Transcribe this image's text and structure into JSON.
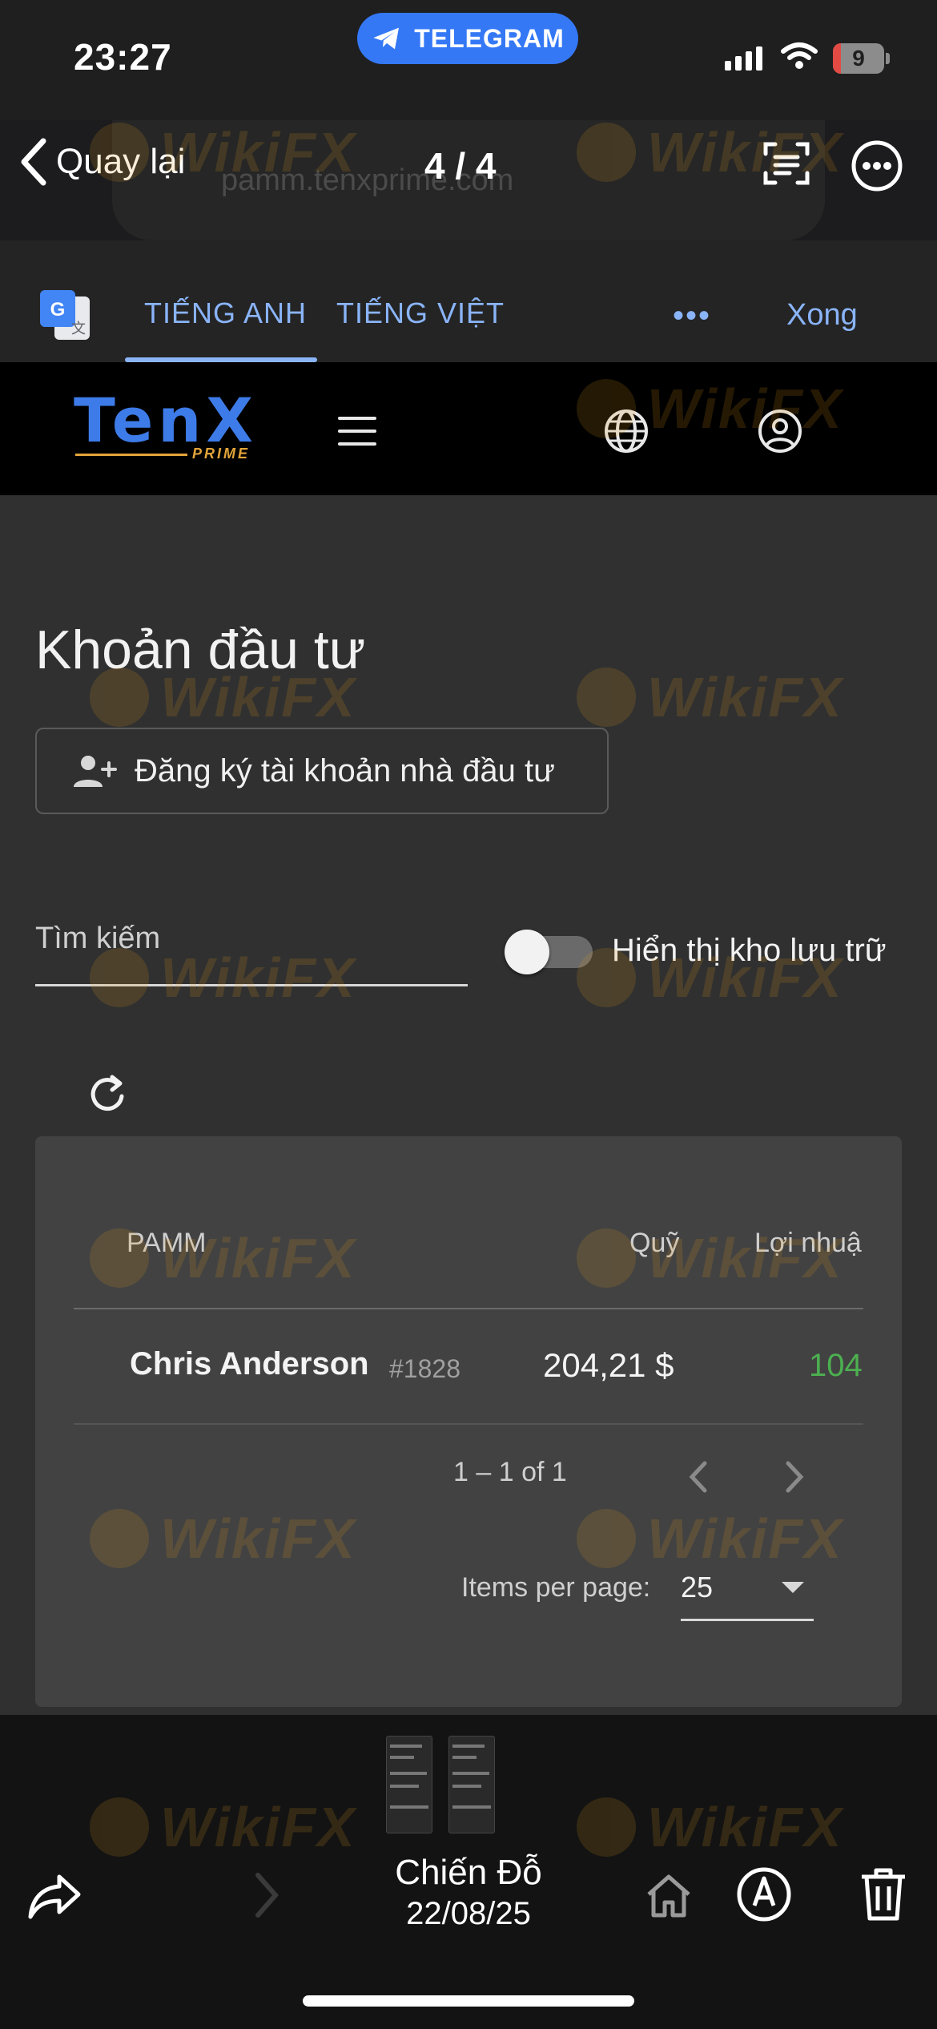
{
  "status_bar": {
    "time": "23:27",
    "app_pill": "TELEGRAM",
    "battery": "9"
  },
  "viewer": {
    "back_label": "Quay lại",
    "page_counter": "4 / 4",
    "url_ghost": "pamm.tenxprime.com"
  },
  "translate_bar": {
    "tab_english": "TIẾNG ANH",
    "tab_vietnamese": "TIẾNG VIỆT",
    "more": "•••",
    "done_label": "Xong"
  },
  "site_nav": {
    "logo_text": "TenX",
    "logo_sub": "PRIME"
  },
  "page": {
    "title": "Khoản đầu tư",
    "register_button": "Đăng ký tài khoản nhà đầu tư",
    "search_label": "Tìm kiếm",
    "archive_toggle_label": "Hiển thị kho lưu trữ",
    "archive_toggle_on": false
  },
  "table": {
    "columns": [
      "PAMM",
      "Quỹ",
      "Lợi nhuậ"
    ],
    "rows": [
      {
        "name": "Chris Anderson",
        "id": "#1828",
        "fund": "204,21 $",
        "profit": "104"
      }
    ],
    "range_label": "1 – 1 of 1",
    "items_per_page_label": "Items per page:",
    "items_per_page_value": "25"
  },
  "bottom_toolbar": {
    "sender": "Chiến Đỗ",
    "date": "22/08/25"
  },
  "watermark": "WikiFX",
  "colors": {
    "telegram_blue": "#3478f6",
    "translate_accent": "#8ab4f8",
    "profit_green": "#4caf50",
    "logo_blue": "#3d7be8",
    "logo_gold": "#e2a43a"
  }
}
